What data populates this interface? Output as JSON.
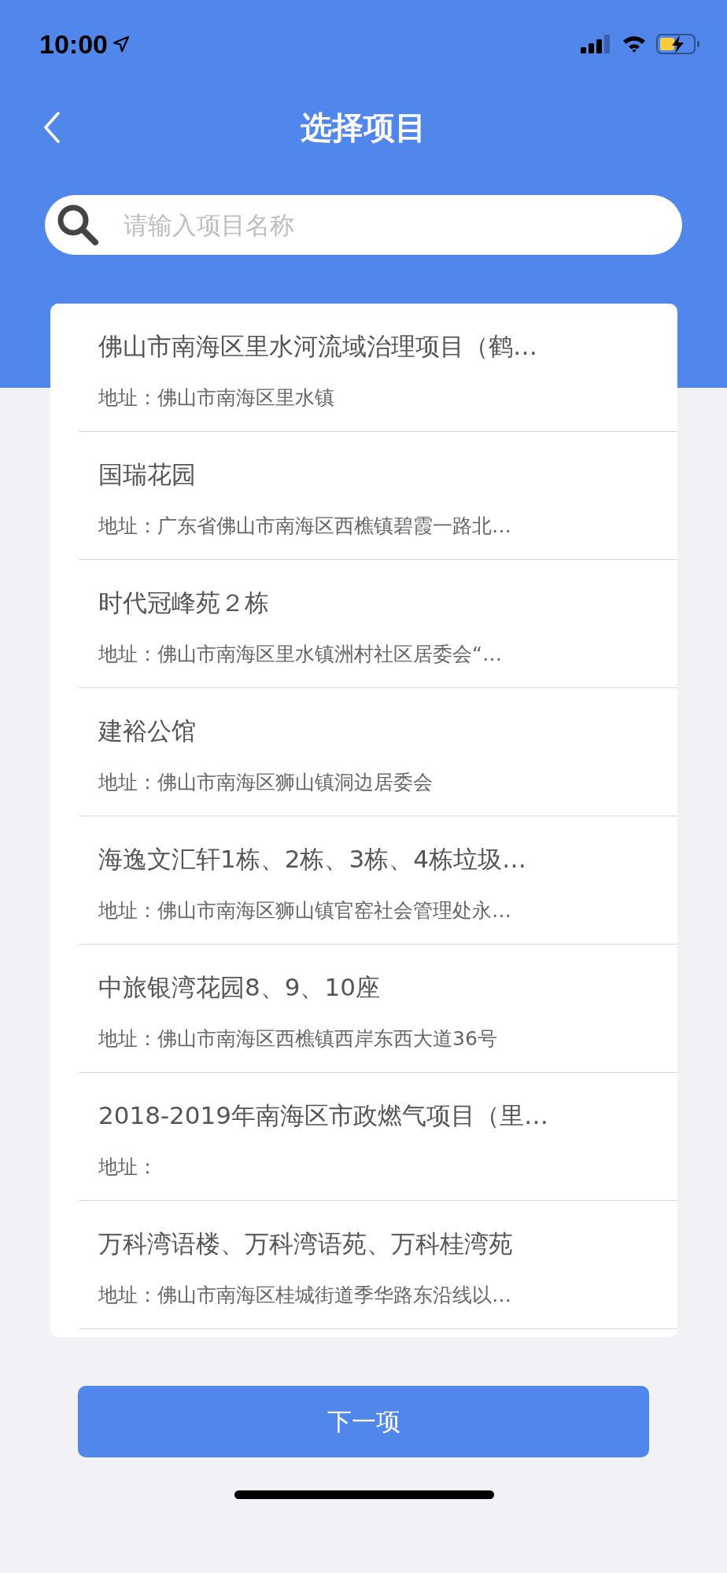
{
  "status_bar": {
    "time": "10:00"
  },
  "nav": {
    "title": "选择项目"
  },
  "search": {
    "placeholder": "请输入项目名称"
  },
  "projects": [
    {
      "name": "佛山市南海区里水河流域治理项目（鹤…",
      "address": "地址：佛山市南海区里水镇"
    },
    {
      "name": "国瑞花园",
      "address": "地址：广东省佛山市南海区西樵镇碧霞一路北…"
    },
    {
      "name": "时代冠峰苑２栋",
      "address": "地址：佛山市南海区里水镇洲村社区居委会“…"
    },
    {
      "name": "建裕公馆",
      "address": "地址：佛山市南海区狮山镇洞边居委会"
    },
    {
      "name": "海逸文汇轩1栋、2栋、3栋、4栋垃圾…",
      "address": "地址：佛山市南海区狮山镇官窑社会管理处永…"
    },
    {
      "name": "中旅银湾花园8、9、10座",
      "address": "地址：佛山市南海区西樵镇西岸东西大道36号"
    },
    {
      "name": "2018-2019年南海区市政燃气项目（里…",
      "address": "地址："
    },
    {
      "name": "万科湾语楼、万科湾语苑、万科桂湾苑",
      "address": "地址：佛山市南海区桂城街道季华路东沿线以…"
    }
  ],
  "next_button": {
    "label": "下一项"
  }
}
